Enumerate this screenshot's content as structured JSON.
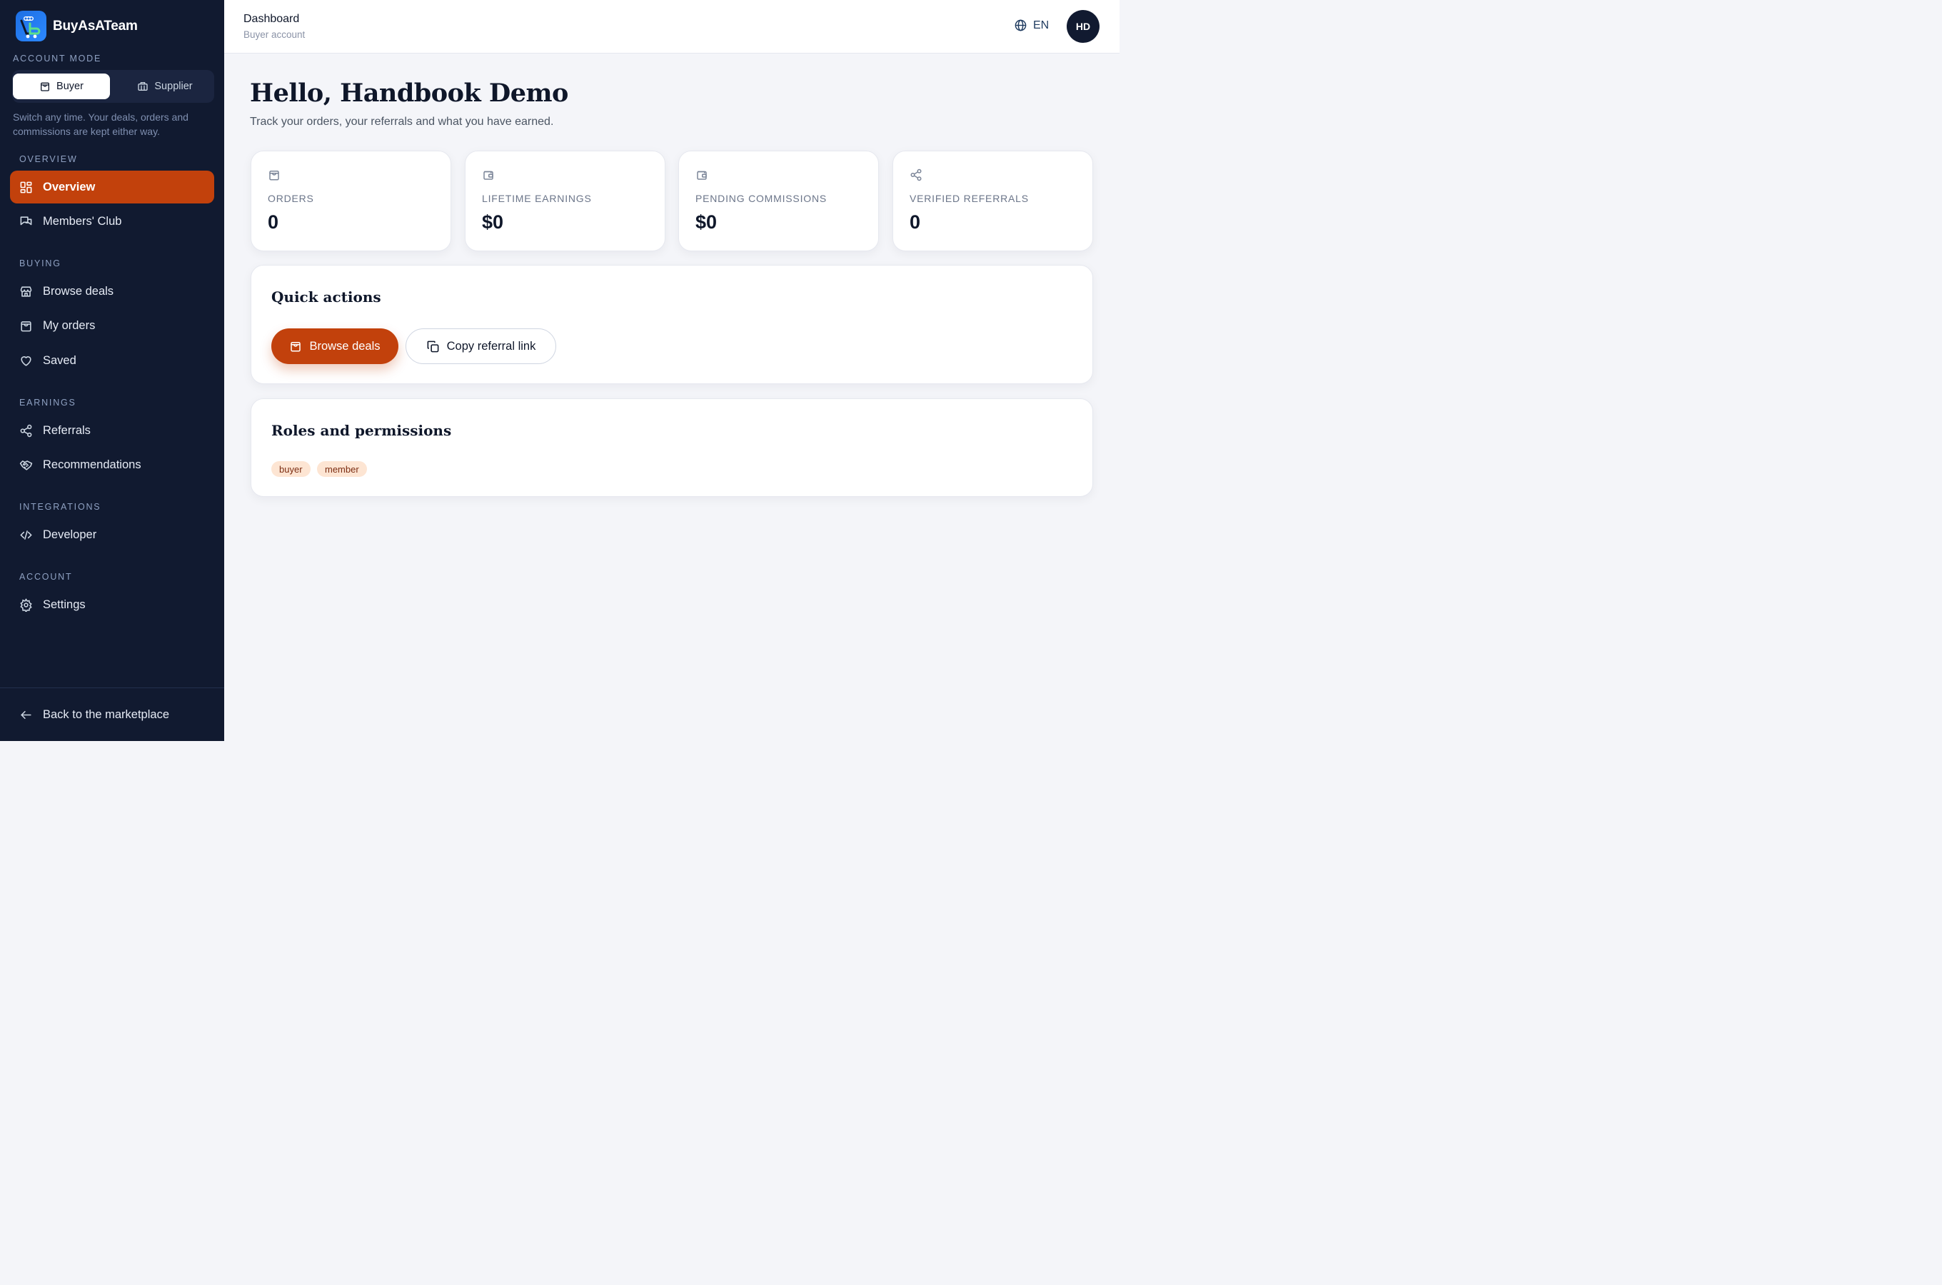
{
  "sidebar": {
    "brand": {
      "name": "BuyAsATeam"
    },
    "account_mode": {
      "label": "Account mode",
      "options": [
        {
          "label": "Buyer",
          "icon": "shopping-bag-icon",
          "active": true
        },
        {
          "label": "Supplier",
          "icon": "store-icon",
          "active": false
        }
      ],
      "hint": "Switch any time. Your deals, orders and commissions are kept either way."
    },
    "sections": [
      {
        "label": "Overview",
        "items": [
          {
            "label": "Overview",
            "icon": "dashboard-grid-icon",
            "active": true
          },
          {
            "label": "Members' Club",
            "icon": "chat-icon",
            "active": false
          }
        ]
      },
      {
        "label": "Buying",
        "items": [
          {
            "label": "Browse deals",
            "icon": "storefront-icon",
            "active": false
          },
          {
            "label": "My orders",
            "icon": "shopping-bag-icon",
            "active": false
          },
          {
            "label": "Saved",
            "icon": "heart-icon",
            "active": false
          }
        ]
      },
      {
        "label": "Earnings",
        "items": [
          {
            "label": "Referrals",
            "icon": "share-icon",
            "active": false
          },
          {
            "label": "Recommendations",
            "icon": "handshake-icon",
            "active": false
          }
        ]
      },
      {
        "label": "Integrations",
        "items": [
          {
            "label": "Developer",
            "icon": "code-icon",
            "active": false
          }
        ]
      },
      {
        "label": "Account",
        "items": [
          {
            "label": "Settings",
            "icon": "gear-icon",
            "active": false
          }
        ]
      }
    ],
    "back_link": {
      "label": "Back to the marketplace",
      "icon": "arrow-left-icon"
    }
  },
  "header": {
    "title": "Dashboard",
    "subtitle": "Buyer account",
    "language": "EN",
    "avatar_initials": "HD"
  },
  "main": {
    "greeting": "Hello, Handbook Demo",
    "subtitle": "Track your orders, your referrals and what you have earned.",
    "stats": [
      {
        "label": "Orders",
        "value": "0",
        "icon": "shopping-bag-icon"
      },
      {
        "label": "Lifetime earnings",
        "value": "$0",
        "icon": "wallet-icon"
      },
      {
        "label": "Pending commissions",
        "value": "$0",
        "icon": "wallet-icon"
      },
      {
        "label": "Verified referrals",
        "value": "0",
        "icon": "share-icon"
      }
    ],
    "quick_actions": {
      "title": "Quick actions",
      "primary_label": "Browse deals",
      "secondary_label": "Copy referral link"
    },
    "roles": {
      "title": "Roles and permissions",
      "tags": [
        "buyer",
        "member"
      ]
    }
  },
  "colors": {
    "sidebar_bg": "#111a30",
    "accent": "#c2410c",
    "page_bg": "#f4f5f9",
    "tag_bg": "#fde5d3"
  }
}
